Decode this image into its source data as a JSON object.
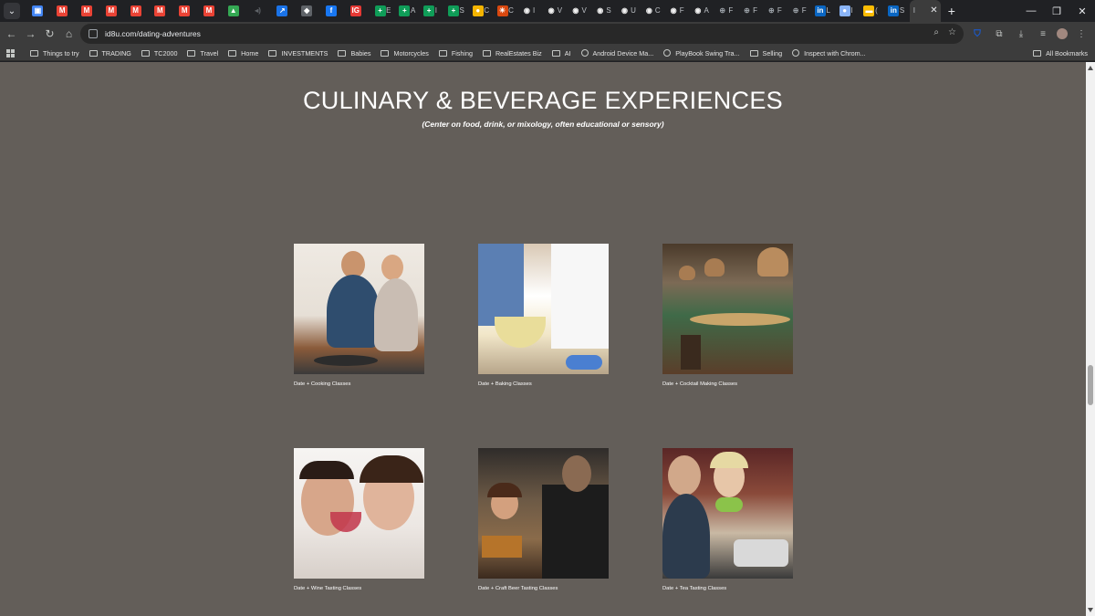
{
  "browser": {
    "tabs": [
      {
        "icon": "grid-app-icon",
        "color": "#4285f4",
        "glyph": "▣",
        "label": ""
      },
      {
        "icon": "gmail-icon",
        "color": "#ea4335",
        "glyph": "M",
        "label": ""
      },
      {
        "icon": "gmail-icon",
        "color": "#ea4335",
        "glyph": "M",
        "label": ""
      },
      {
        "icon": "gmail-icon",
        "color": "#ea4335",
        "glyph": "M",
        "label": ""
      },
      {
        "icon": "gmail-icon",
        "color": "#ea4335",
        "glyph": "M",
        "label": ""
      },
      {
        "icon": "gmail-icon",
        "color": "#ea4335",
        "glyph": "M",
        "label": ""
      },
      {
        "icon": "gmail-icon",
        "color": "#ea4335",
        "glyph": "M",
        "label": ""
      },
      {
        "icon": "gmail-icon",
        "color": "#ea4335",
        "glyph": "M",
        "label": ""
      },
      {
        "icon": "google-drive-icon",
        "color": "#34a853",
        "glyph": "▲",
        "label": ""
      },
      {
        "icon": "audio-icon",
        "color": "#5f6368",
        "glyph": "◂)",
        "label": ""
      },
      {
        "icon": "chart-app-icon",
        "color": "#1a73e8",
        "glyph": "↗",
        "label": ""
      },
      {
        "icon": "shield-app-icon",
        "color": "#5f6368",
        "glyph": "◆",
        "label": ""
      },
      {
        "icon": "facebook-icon",
        "color": "#1877f2",
        "glyph": "f",
        "label": ""
      },
      {
        "icon": "ig-icon",
        "color": "#e53935",
        "glyph": "IG",
        "label": ""
      },
      {
        "icon": "sheets-icon",
        "color": "#0f9d58",
        "glyph": "+",
        "label": "E"
      },
      {
        "icon": "sheets-icon",
        "color": "#0f9d58",
        "glyph": "+",
        "label": "A"
      },
      {
        "icon": "sheets-icon",
        "color": "#0f9d58",
        "glyph": "+",
        "label": "I"
      },
      {
        "icon": "sheets-icon",
        "color": "#0f9d58",
        "glyph": "+",
        "label": "S"
      },
      {
        "icon": "sun-icon",
        "color": "#f4b400",
        "glyph": "●",
        "label": "C"
      },
      {
        "icon": "spark-icon",
        "color": "#d9480f",
        "glyph": "✳",
        "label": "C"
      },
      {
        "icon": "github-icon",
        "color": "#f0f0f0",
        "glyph": "◉",
        "label": "I"
      },
      {
        "icon": "github-icon",
        "color": "#f0f0f0",
        "glyph": "◉",
        "label": "V"
      },
      {
        "icon": "github-icon",
        "color": "#f0f0f0",
        "glyph": "◉",
        "label": "V"
      },
      {
        "icon": "github-icon",
        "color": "#f0f0f0",
        "glyph": "◉",
        "label": "S"
      },
      {
        "icon": "github-icon",
        "color": "#f0f0f0",
        "glyph": "◉",
        "label": "U"
      },
      {
        "icon": "github-icon",
        "color": "#f0f0f0",
        "glyph": "◉",
        "label": "C"
      },
      {
        "icon": "github-icon",
        "color": "#f0f0f0",
        "glyph": "◉",
        "label": "F"
      },
      {
        "icon": "github-icon",
        "color": "#f0f0f0",
        "glyph": "◉",
        "label": "A"
      },
      {
        "icon": "globe-icon",
        "color": "#9aa0a6",
        "glyph": "⊕",
        "label": "F"
      },
      {
        "icon": "globe-icon",
        "color": "#9aa0a6",
        "glyph": "⊕",
        "label": "F"
      },
      {
        "icon": "globe-icon",
        "color": "#9aa0a6",
        "glyph": "⊕",
        "label": "F"
      },
      {
        "icon": "globe-icon",
        "color": "#9aa0a6",
        "glyph": "⊕",
        "label": "F"
      },
      {
        "icon": "linkedin-icon",
        "color": "#0a66c2",
        "glyph": "in",
        "label": "L"
      },
      {
        "icon": "site-icon",
        "color": "#8ab4f8",
        "glyph": "●",
        "label": "I"
      },
      {
        "icon": "flag-icon",
        "color": "#fbbc04",
        "glyph": "▬",
        "label": "("
      },
      {
        "icon": "linkedin-icon",
        "color": "#0a66c2",
        "glyph": "in",
        "label": "S"
      }
    ],
    "active_tab_label": "I",
    "new_tab": "+",
    "url": "id8u.com/dating-adventures"
  },
  "bookmarks": [
    {
      "type": "folder",
      "label": "Things to try"
    },
    {
      "type": "folder",
      "label": "TRADING"
    },
    {
      "type": "folder",
      "label": "TC2000"
    },
    {
      "type": "folder",
      "label": "Travel"
    },
    {
      "type": "folder",
      "label": "Home"
    },
    {
      "type": "folder",
      "label": "INVESTMENTS"
    },
    {
      "type": "folder",
      "label": "Babies"
    },
    {
      "type": "folder",
      "label": "Motorcycles"
    },
    {
      "type": "folder",
      "label": "Fishing"
    },
    {
      "type": "folder",
      "label": "RealEstates Biz"
    },
    {
      "type": "folder",
      "label": "AI"
    },
    {
      "type": "site",
      "label": "Android Device Ma..."
    },
    {
      "type": "site",
      "label": "PlayBook Swing Tra..."
    },
    {
      "type": "folder",
      "label": "Selling"
    },
    {
      "type": "site",
      "label": "Inspect with Chrom..."
    }
  ],
  "all_bookmarks": "All Bookmarks",
  "page": {
    "title": "CULINARY & BEVERAGE EXPERIENCES",
    "subtitle": "(Center on food, drink, or mixology, often educational or sensory)",
    "cards": [
      {
        "caption": "Date + Cooking Classes"
      },
      {
        "caption": "Date + Baking Classes"
      },
      {
        "caption": "Date + Cocktail Making Classes"
      },
      {
        "caption": "Date + Wine Tasting Classes"
      },
      {
        "caption": "Date + Craft Beer Tasting Classes"
      },
      {
        "caption": "Date + Tea Tasting Classes"
      }
    ]
  },
  "colors": {
    "page_background": "#635e59",
    "browser_chrome": "#3c3c3c",
    "tab_strip": "#202124",
    "text": "#ffffff"
  }
}
